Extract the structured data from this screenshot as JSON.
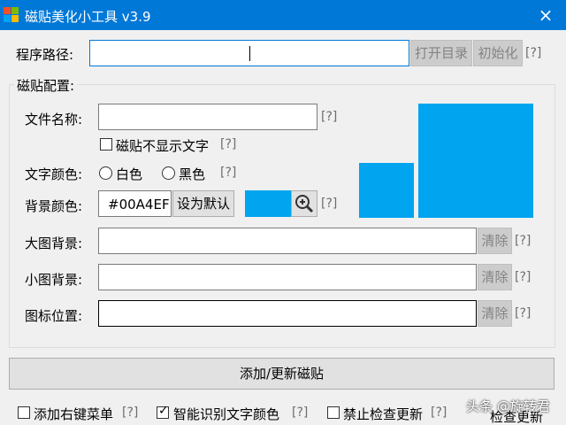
{
  "titlebar": {
    "title": "磁贴美化小工具 v3.9",
    "close_icon": "×"
  },
  "program_path": {
    "label": "程序路径:",
    "value": "",
    "open_dir": "打开目录",
    "init": "初始化",
    "help": "[?]"
  },
  "tile_config": {
    "group_title": "磁贴配置:",
    "file_name": {
      "label": "文件名称:",
      "value": "",
      "help": "[?]"
    },
    "hide_text": {
      "label": "磁贴不显示文字",
      "checked": false,
      "help": "[?]"
    },
    "text_color": {
      "label": "文字颜色:",
      "white": "白色",
      "black": "黑色",
      "help": "[?]"
    },
    "bg_color": {
      "label": "背景颜色:",
      "value": "#00A4EF",
      "default_btn": "设为默认",
      "swatch": "#00a4ef",
      "zoom_icon": "magnifier-plus",
      "help": "[?]"
    },
    "large_bg": {
      "label": "大图背景:",
      "value": "",
      "clear": "清除",
      "help": "[?]"
    },
    "small_bg": {
      "label": "小图背景:",
      "value": "",
      "clear": "清除",
      "help": "[?]"
    },
    "icon_pos": {
      "label": "图标位置:",
      "value": "",
      "clear": "清除",
      "help": "[?]"
    },
    "preview_color": "#00a4ef"
  },
  "apply_button": "添加/更新磁贴",
  "footer": {
    "context_menu": {
      "label": "添加右键菜单",
      "checked": false,
      "help": "[?]"
    },
    "smart_color": {
      "label": "智能识别文字颜色",
      "checked": true,
      "help": "[?]"
    },
    "no_update": {
      "label": "禁止检查更新",
      "checked": false,
      "help": "[?]"
    },
    "check_update": "检查更新"
  },
  "watermark": "头条 @旋转君"
}
